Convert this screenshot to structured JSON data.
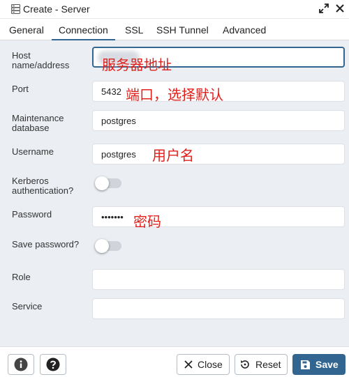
{
  "window": {
    "title": "Create - Server"
  },
  "tabs": [
    {
      "label": "General",
      "active": false
    },
    {
      "label": "Connection",
      "active": true
    },
    {
      "label": "SSL",
      "active": false
    },
    {
      "label": "SSH Tunnel",
      "active": false
    },
    {
      "label": "Advanced",
      "active": false
    }
  ],
  "fields": {
    "host": {
      "label": "Host name/address",
      "value": "",
      "annotation": "服务器地址"
    },
    "port": {
      "label": "Port",
      "value": "5432",
      "annotation": "端口，选择默认"
    },
    "maintenance_db": {
      "label": "Maintenance database",
      "value": "postgres"
    },
    "username": {
      "label": "Username",
      "value": "postgres",
      "annotation": "用户名"
    },
    "kerberos": {
      "label": "Kerberos authentication?",
      "checked": false
    },
    "password": {
      "label": "Password",
      "value": "•••••••",
      "annotation": "密码"
    },
    "save_password": {
      "label": "Save password?",
      "checked": false
    },
    "role": {
      "label": "Role",
      "value": ""
    },
    "service": {
      "label": "Service",
      "value": ""
    }
  },
  "footer": {
    "close_label": "Close",
    "reset_label": "Reset",
    "save_label": "Save"
  },
  "colors": {
    "accent": "#326690",
    "annotation": "#e0201c",
    "form_bg": "#ebeef3"
  }
}
